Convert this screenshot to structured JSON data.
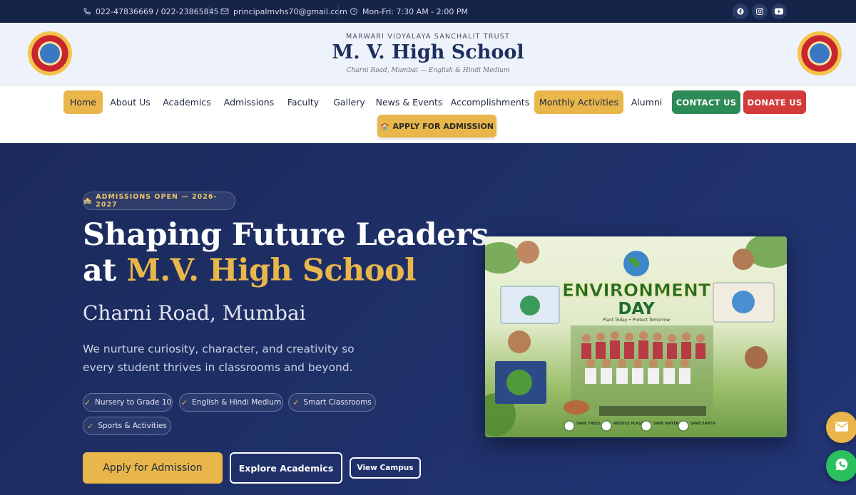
{
  "topbar": {
    "phone": "022-47836669 / 022-23865845",
    "email": "principalmvhs70@gmail.com",
    "hours": "Mon-Fri: 7:30 AM - 2:00 PM",
    "social_icons": [
      "facebook-icon",
      "instagram-icon",
      "youtube-icon"
    ]
  },
  "header": {
    "trust": "MARWARI VIDYALAYA SANCHALIT TRUST",
    "school_name": "M. V. High School",
    "tagline": "Charni Road, Mumbai — English & Hindi Medium"
  },
  "nav": {
    "items": [
      "Home",
      "About Us",
      "Academics",
      "Admissions",
      "Faculty",
      "Gallery",
      "News & Events",
      "Accomplishments",
      "Monthly Activities",
      "Alumni"
    ],
    "contact": "CONTACT US",
    "donate": "DONATE US",
    "apply": "APPLY FOR ADMISSION"
  },
  "hero": {
    "badge": "ADMISSIONS OPEN — 2026-2027",
    "title_line1": "Shaping Future Leaders",
    "title_at": "at ",
    "title_highlight": "M.V. High School",
    "subtitle": "Charni Road, Mumbai",
    "description": "We nurture curiosity, character, and creativity so every student thrives in classrooms and beyond.",
    "features": [
      "Nursery to Grade 10",
      "English & Hindi Medium",
      "Smart Classrooms",
      "Sports & Activities"
    ],
    "btn_apply": "Apply for Admission",
    "btn_explore": "Explore Academics",
    "btn_campus": "View Campus"
  },
  "poster": {
    "title": "ENVIRONMENT",
    "title2": "DAY",
    "slogan": "Plant Today • Protect Tomorrow",
    "labels": [
      "SAVE TREES",
      "REDUCE PLASTIC",
      "SAVE WATER",
      "SAVE EARTH"
    ]
  },
  "colors": {
    "navy": "#17244a",
    "gold": "#e8b64a",
    "green": "#2e8b57",
    "red": "#d33a3a"
  }
}
